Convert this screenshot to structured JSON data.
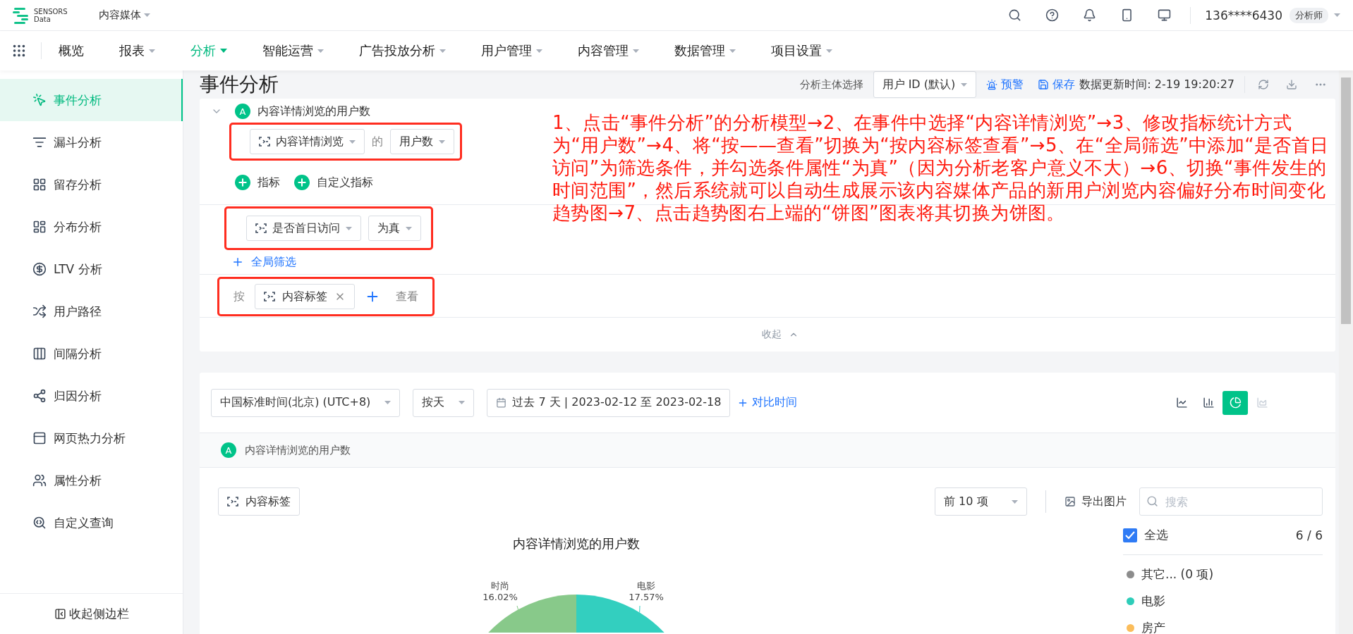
{
  "header": {
    "logo": [
      "SENSORS",
      "Data"
    ],
    "project": "内容媒体",
    "user": "136****6430",
    "role": "分析师"
  },
  "nav": [
    {
      "label": "概览",
      "dropdown": false,
      "selected": false
    },
    {
      "label": "报表",
      "dropdown": true,
      "selected": false
    },
    {
      "label": "分析",
      "dropdown": true,
      "selected": true
    },
    {
      "label": "智能运营",
      "dropdown": true,
      "selected": false
    },
    {
      "label": "广告投放分析",
      "dropdown": true,
      "selected": false
    },
    {
      "label": "用户管理",
      "dropdown": true,
      "selected": false
    },
    {
      "label": "内容管理",
      "dropdown": true,
      "selected": false
    },
    {
      "label": "数据管理",
      "dropdown": true,
      "selected": false
    },
    {
      "label": "项目设置",
      "dropdown": true,
      "selected": false
    }
  ],
  "sidebar": {
    "items": [
      {
        "label": "事件分析",
        "selected": true
      },
      {
        "label": "漏斗分析",
        "selected": false
      },
      {
        "label": "留存分析",
        "selected": false
      },
      {
        "label": "分布分析",
        "selected": false
      },
      {
        "label": "LTV 分析",
        "selected": false
      },
      {
        "label": "用户路径",
        "selected": false
      },
      {
        "label": "间隔分析",
        "selected": false
      },
      {
        "label": "归因分析",
        "selected": false
      },
      {
        "label": "网页热力分析",
        "selected": false
      },
      {
        "label": "属性分析",
        "selected": false
      },
      {
        "label": "自定义查询",
        "selected": false
      }
    ],
    "collapse": "收起侧边栏"
  },
  "page": {
    "title": "事件分析",
    "subject_label": "分析主体选择",
    "subject": "用户 ID (默认)",
    "alert": "预警",
    "save": "保存",
    "updated": "数据更新时间: 2-19 19:20:27"
  },
  "query": {
    "metric": {
      "badge": "A",
      "name": "内容详情浏览的用户数",
      "expanded": true,
      "event": "内容详情浏览",
      "of": "的",
      "measure": "用户数"
    },
    "add_buttons": [
      "指标",
      "自定义指标"
    ],
    "filter": {
      "property": "是否首日访问",
      "operator": "为真"
    },
    "global_filter": "全局筛选",
    "group_by": {
      "prefix": "按",
      "property": "内容标签",
      "suffix": "查看"
    },
    "collapse": "收起"
  },
  "annotation": "1、点击“事件分析”的分析模型→2、在事件中选择“内容详情浏览”→3、修改指标统计方式为“用户数”→4、将“按——查看”切换为“按内容标签查看”→5、在“全局筛选”中添加“是否首日访问”为筛选条件，并勾选条件属性“为真”（因为分析老客户意义不大）→6、切换“事件发生的时间范围”，然后系统就可以自动生成展示该内容媒体产品的新用户浏览内容偏好分布时间变化趋势图→7、点击趋势图右上端的“饼图”图表将其切换为饼图。",
  "result": {
    "timezone": "中国标准时间(北京) (UTC+8)",
    "granularity": "按天",
    "date_range": "过去 7 天 | 2023-02-12 至 2023-02-18",
    "compare": "对比时间",
    "chart_types": [
      {
        "kind": "line",
        "selected": false,
        "disabled": false
      },
      {
        "kind": "bar",
        "selected": false,
        "disabled": false
      },
      {
        "kind": "pie",
        "selected": true,
        "disabled": false
      },
      {
        "kind": "area",
        "selected": false,
        "disabled": true
      }
    ],
    "series_badge": "A",
    "series_name": "内容详情浏览的用户数",
    "group_chip": "内容标签",
    "top_n": "前 10 项",
    "export": "导出图片",
    "search": {
      "placeholder": "搜索"
    },
    "legend": {
      "select_all": {
        "label": "全选",
        "checked": true
      },
      "count": "6 / 6",
      "items": [
        {
          "label": "其它... (0 项)",
          "color": "#8c8c8c"
        },
        {
          "label": "电影",
          "color": "#2ecdb9"
        },
        {
          "label": "房产",
          "color": "#fbbd5b"
        }
      ]
    },
    "pie": {
      "title": "内容详情浏览的用户数",
      "slices": [
        {
          "label": "时尚",
          "value_label": "16.02%",
          "color": "#88c98a"
        },
        {
          "label": "电影",
          "value_label": "17.57%",
          "color": "#33cfbf"
        }
      ]
    }
  }
}
